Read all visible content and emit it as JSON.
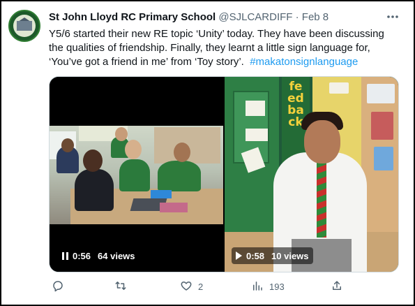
{
  "tweet": {
    "display_name": "St John Lloyd RC Primary School",
    "handle": "@SJLCARDIFF",
    "separator": "·",
    "date": "Feb 8",
    "text_line1": "Y5/6 started their new RE topic ‘Unity’ today.  They have been discussing",
    "text_line2": "the qualities of friendship.  Finally, they learnt a little sign language for,",
    "text_line3": "‘You’ve got a friend in me’ from ‘Toy story’.",
    "hashtag": "#makatonsignlanguage",
    "more_icon": "more-icon"
  },
  "fb_board_text": "feedback",
  "videos": [
    {
      "state_icon": "pause-icon",
      "time": "0:56",
      "views": "64 views"
    },
    {
      "state_icon": "play-icon",
      "time": "0:58",
      "views": "10 views"
    }
  ],
  "actions": {
    "reply_icon": "reply-icon",
    "retweet_icon": "retweet-icon",
    "like_icon": "heart-icon",
    "like_count": "2",
    "views_icon": "analytics-icon",
    "views_count": "193",
    "share_icon": "share-icon"
  },
  "colors": {
    "link": "#1d9bf0",
    "muted": "#536471",
    "text": "#0f1419"
  }
}
